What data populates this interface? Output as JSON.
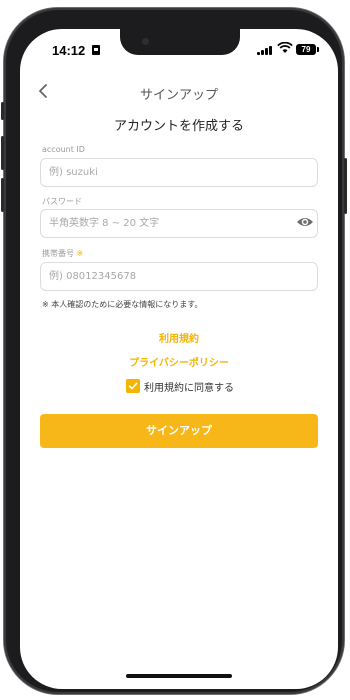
{
  "status_bar": {
    "time": "14:12",
    "battery": "79"
  },
  "nav": {
    "title": "サインアップ"
  },
  "page": {
    "heading": "アカウントを作成する"
  },
  "form": {
    "account_id": {
      "label": "account ID",
      "placeholder": "例) suzuki"
    },
    "password": {
      "label": "パスワード",
      "placeholder": "半角英数字 8 ~ 20 文字"
    },
    "phone": {
      "label": "携帯番号",
      "required_mark": "※",
      "placeholder": "例) 08012345678"
    },
    "note": "※ 本人確認のために必要な情報になります。"
  },
  "links": {
    "terms": "利用規約",
    "privacy": "プライバシーポリシー"
  },
  "agreement": {
    "label": "利用規約に同意する",
    "checked": true
  },
  "submit": {
    "label": "サインアップ"
  },
  "colors": {
    "accent": "#f5b400",
    "button": "#f7b718",
    "frame": "#1c1c1e"
  }
}
